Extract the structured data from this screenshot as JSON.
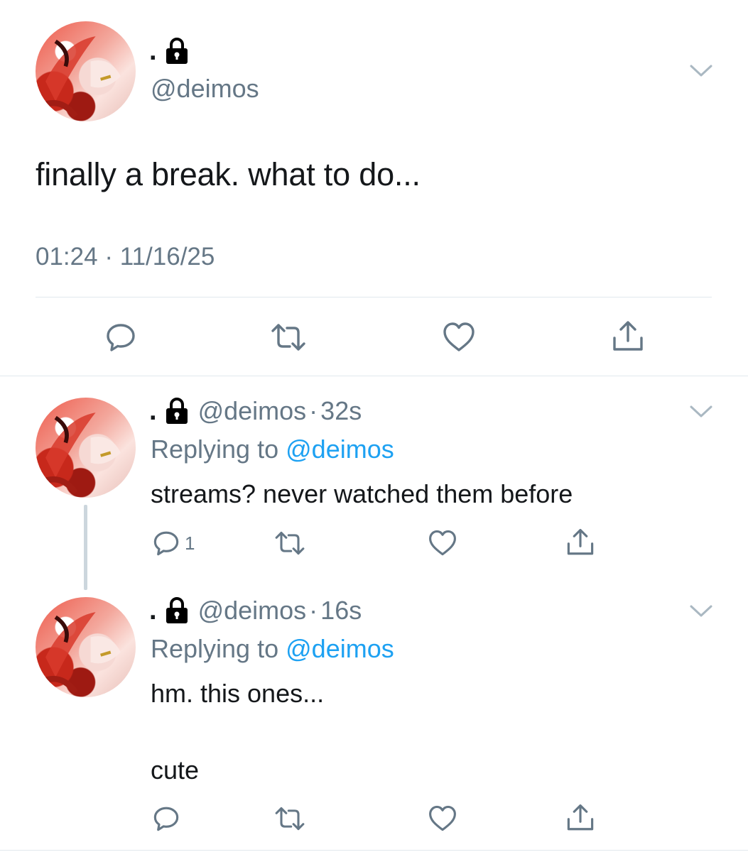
{
  "main_tweet": {
    "display_name": ".",
    "handle": "@deimos",
    "text": "finally a break. what to do...",
    "time": "01:24",
    "separator": "·",
    "date": "11/16/25"
  },
  "replies": [
    {
      "display_name": ".",
      "handle": "@deimos",
      "separator": "·",
      "age": "32s",
      "replying_prefix": "Replying to",
      "replying_to": "@deimos",
      "lines": [
        "streams? never watched them before"
      ],
      "reply_count": "1"
    },
    {
      "display_name": ".",
      "handle": "@deimos",
      "separator": "·",
      "age": "16s",
      "replying_prefix": "Replying to",
      "replying_to": "@deimos",
      "lines": [
        "hm. this ones...",
        "cute"
      ],
      "reply_count": ""
    }
  ],
  "icons": {
    "lock": "lock-icon",
    "chevron": "chevron-down-icon",
    "reply": "reply-icon",
    "retweet": "retweet-icon",
    "like": "heart-icon",
    "share": "share-icon"
  },
  "colors": {
    "text": "#14171a",
    "secondary": "#657786",
    "link": "#1da1f2",
    "divider": "#e1e8ed",
    "thread_line": "#ccd6dd"
  }
}
